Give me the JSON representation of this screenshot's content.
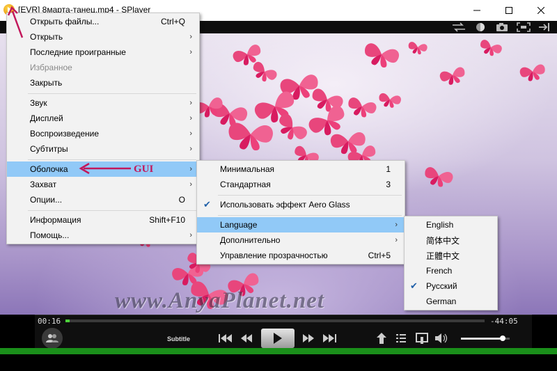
{
  "window": {
    "title": "[EVR] 8марта-танец.mp4 - SPlayer"
  },
  "main_menu": {
    "items": [
      {
        "label": "Открыть файлы...",
        "shortcut": "Ctrl+Q"
      },
      {
        "label": "Открыть",
        "arrow": "›"
      },
      {
        "label": "Последние проигранные",
        "arrow": "›"
      },
      {
        "label": "Избранное"
      },
      {
        "label": "Закрыть"
      },
      {
        "label": "Звук",
        "arrow": "›"
      },
      {
        "label": "Дисплей",
        "arrow": "›"
      },
      {
        "label": "Воспроизведение",
        "arrow": "›"
      },
      {
        "label": "Субтитры",
        "arrow": "›"
      },
      {
        "label": "Оболочка",
        "arrow": "›"
      },
      {
        "label": "Захват",
        "arrow": "›"
      },
      {
        "label": "Опции...",
        "shortcut": "O"
      },
      {
        "label": "Информация",
        "shortcut": "Shift+F10"
      },
      {
        "label": "Помощь...",
        "arrow": "›"
      }
    ]
  },
  "shell_menu": {
    "items": [
      {
        "label": "Минимальная",
        "shortcut": "1"
      },
      {
        "label": "Стандартная",
        "shortcut": "3"
      },
      {
        "label": "Использовать эффект Aero Glass",
        "check": "✔"
      },
      {
        "label": "Language",
        "arrow": "›"
      },
      {
        "label": "Дополнительно",
        "arrow": "›"
      },
      {
        "label": "Управление прозрачностью",
        "shortcut": "Ctrl+5"
      }
    ]
  },
  "language_menu": {
    "items": [
      {
        "label": "English"
      },
      {
        "label": "简体中文"
      },
      {
        "label": "正體中文"
      },
      {
        "label": "French"
      },
      {
        "label": "Русский",
        "check": "✔"
      },
      {
        "label": "German"
      }
    ]
  },
  "annotation": {
    "text": "GUI",
    "color": "#c2185b"
  },
  "watermark": "www.AnyaPlanet.net",
  "player": {
    "time_elapsed": "00:16",
    "time_remaining": "-44:05",
    "progress": 0.01,
    "subtitle_label": "Subtitle",
    "volume": 0.85
  },
  "colors": {
    "highlight": "#91c9f7",
    "menu_bg": "#f2f2f2",
    "butterfly": "#e8467c",
    "progress": "#4cd13a"
  }
}
